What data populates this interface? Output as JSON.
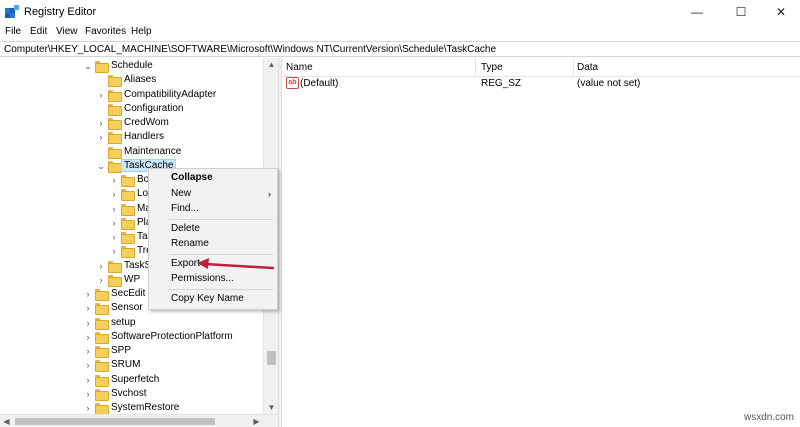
{
  "window": {
    "title": "Registry Editor",
    "controls": {
      "minimize": "—",
      "maximize": "☐",
      "close": "✕"
    }
  },
  "menubar": [
    "File",
    "Edit",
    "View",
    "Favorites",
    "Help"
  ],
  "address": "Computer\\HKEY_LOCAL_MACHINE\\SOFTWARE\\Microsoft\\Windows NT\\CurrentVersion\\Schedule\\TaskCache",
  "tree": [
    {
      "label": "Schedule",
      "chevron": "⌄"
    },
    {
      "label": "Aliases",
      "chevron": ""
    },
    {
      "label": "CompatibilityAdapter",
      "chevron": "›"
    },
    {
      "label": "Configuration",
      "chevron": ""
    },
    {
      "label": "CredWom",
      "chevron": "›"
    },
    {
      "label": "Handlers",
      "chevron": "›"
    },
    {
      "label": "Maintenance",
      "chevron": ""
    },
    {
      "label": "TaskCache",
      "chevron": "⌄",
      "selected": true
    },
    {
      "label": "Bo",
      "chevron": "›"
    },
    {
      "label": "Lo",
      "chevron": "›"
    },
    {
      "label": "Ma",
      "chevron": "›"
    },
    {
      "label": "Pla",
      "chevron": "›"
    },
    {
      "label": "Tas",
      "chevron": "›"
    },
    {
      "label": "Tre",
      "chevron": "›"
    },
    {
      "label": "TaskSt",
      "chevron": "›"
    },
    {
      "label": "WP",
      "chevron": "›"
    },
    {
      "label": "SecEdit",
      "chevron": "›"
    },
    {
      "label": "Sensor",
      "chevron": "›"
    },
    {
      "label": "setup",
      "chevron": "›"
    },
    {
      "label": "SoftwareProtectionPlatform",
      "chevron": "›"
    },
    {
      "label": "SPP",
      "chevron": "›"
    },
    {
      "label": "SRUM",
      "chevron": "›"
    },
    {
      "label": "Superfetch",
      "chevron": "›"
    },
    {
      "label": "Svchost",
      "chevron": "›"
    },
    {
      "label": "SystemRestore",
      "chevron": "›"
    }
  ],
  "list": {
    "columns": [
      "Name",
      "Type",
      "Data"
    ],
    "rows": [
      {
        "icon": "ab-string-icon",
        "name": "(Default)",
        "type": "REG_SZ",
        "data": "(value not set)"
      }
    ]
  },
  "context_menu": {
    "items": [
      "Collapse",
      "New",
      "Find...",
      "Delete",
      "Rename",
      "Export",
      "Permissions...",
      "Copy Key Name"
    ],
    "highlighted": "Export"
  },
  "scroll_arrows": {
    "up": "▲",
    "down": "▼",
    "left": "◀",
    "right": "▶"
  },
  "watermark": "wsxdn.com",
  "colors": {
    "selection": "#cce8ff",
    "arrow_annotation": "#c0203c",
    "folder": "#f6cf5a"
  }
}
